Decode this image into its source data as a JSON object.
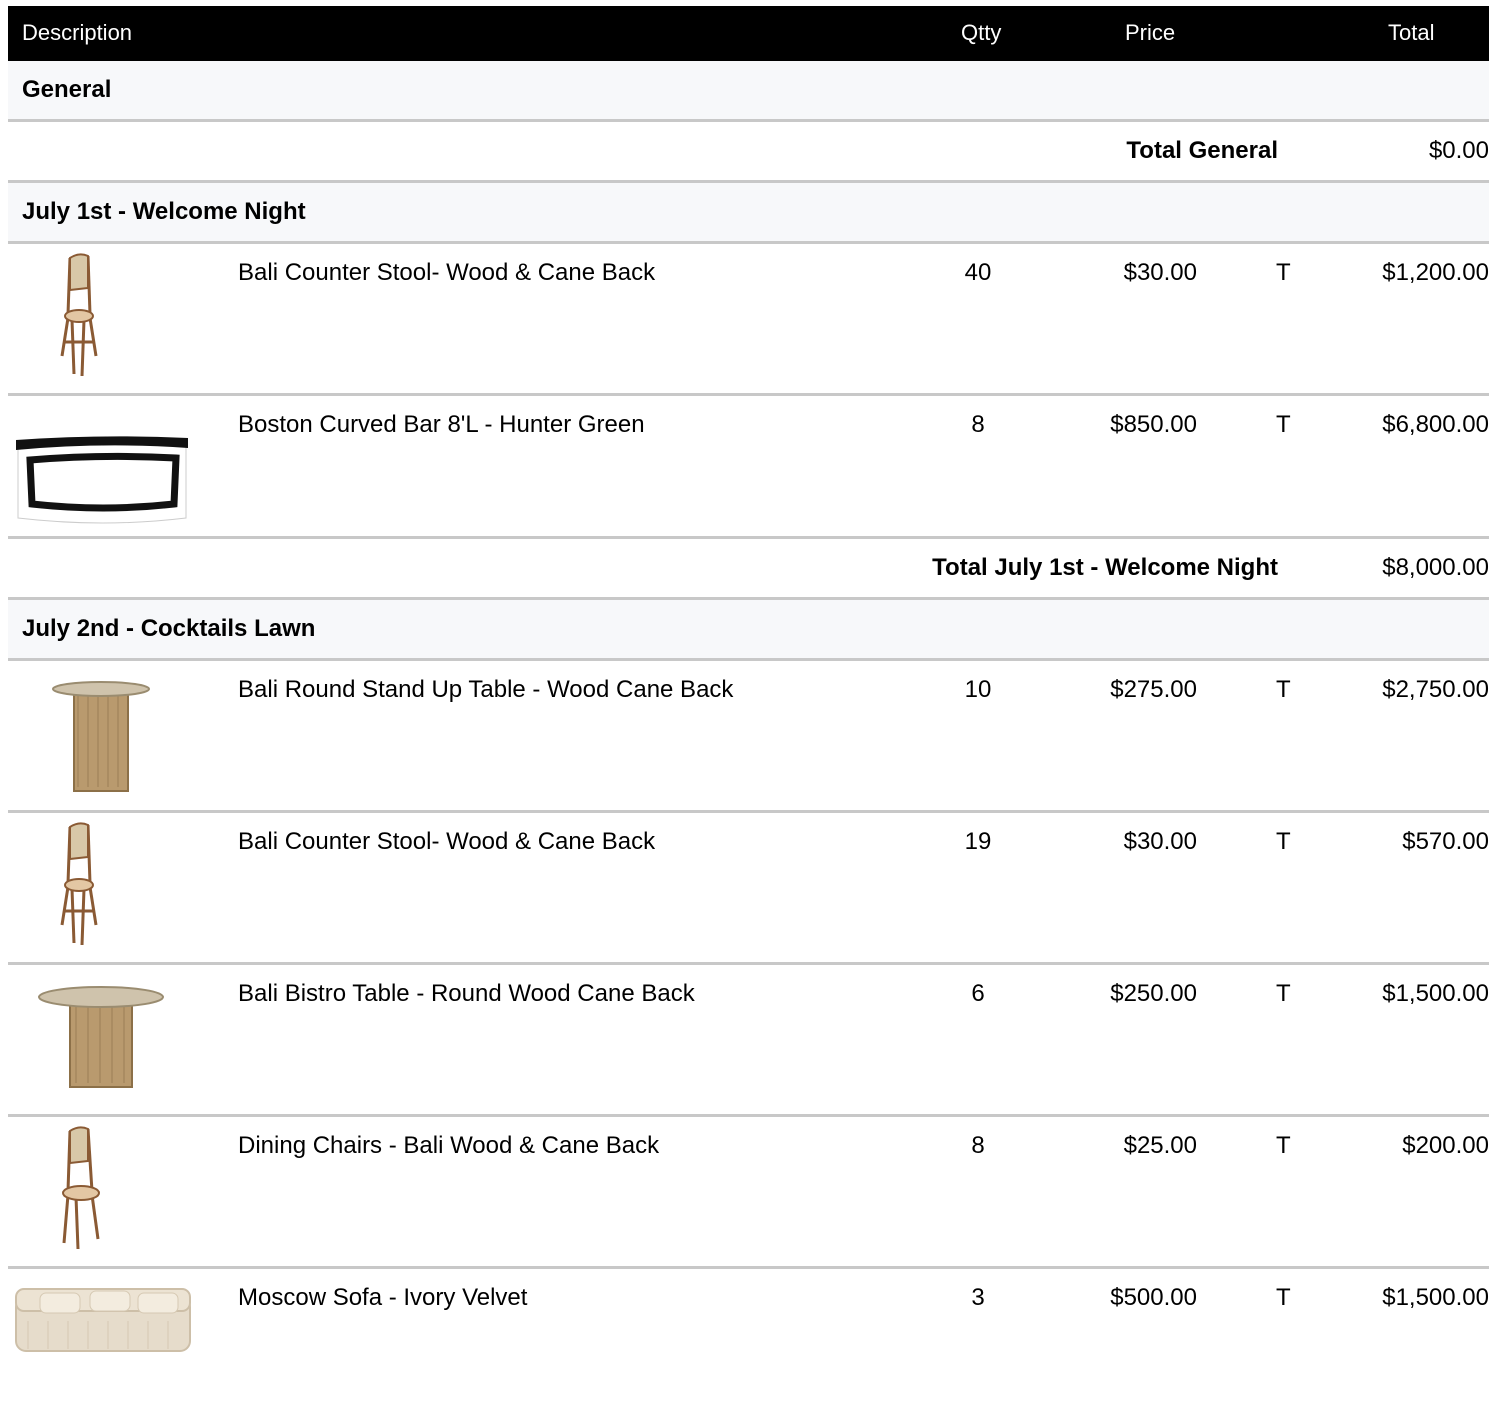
{
  "header": {
    "description": "Description",
    "qty": "Qtty",
    "price": "Price",
    "total": "Total"
  },
  "sections": [
    {
      "title": "General",
      "total_label": "Total General",
      "total_value": "$0.00"
    },
    {
      "title": "July 1st - Welcome Night",
      "total_label": "Total July 1st - Welcome Night",
      "total_value": "$8,000.00"
    },
    {
      "title": "July 2nd - Cocktails Lawn"
    }
  ],
  "items": [
    {
      "description": "Bali  Counter Stool- Wood & Cane Back",
      "qty": "40",
      "price": "$30.00",
      "tax": "T",
      "total": "$1,200.00",
      "icon": "counter-stool-icon"
    },
    {
      "description": "Boston Curved Bar 8'L - Hunter Green",
      "qty": "8",
      "price": "$850.00",
      "tax": "T",
      "total": "$6,800.00",
      "icon": "curved-bar-icon"
    },
    {
      "description": "Bali Round Stand Up Table - Wood Cane Back",
      "qty": "10",
      "price": "$275.00",
      "tax": "T",
      "total": "$2,750.00",
      "icon": "stand-up-table-icon"
    },
    {
      "description": "Bali  Counter Stool- Wood & Cane Back",
      "qty": "19",
      "price": "$30.00",
      "tax": "T",
      "total": "$570.00",
      "icon": "counter-stool-icon"
    },
    {
      "description": "Bali Bistro Table - Round Wood Cane Back",
      "qty": "6",
      "price": "$250.00",
      "tax": "T",
      "total": "$1,500.00",
      "icon": "bistro-table-icon"
    },
    {
      "description": "Dining Chairs - Bali Wood & Cane Back",
      "qty": "8",
      "price": "$25.00",
      "tax": "T",
      "total": "$200.00",
      "icon": "dining-chair-icon"
    },
    {
      "description": "Moscow Sofa - Ivory Velvet",
      "qty": "3",
      "price": "$500.00",
      "tax": "T",
      "total": "$1,500.00",
      "icon": "sofa-icon"
    }
  ]
}
